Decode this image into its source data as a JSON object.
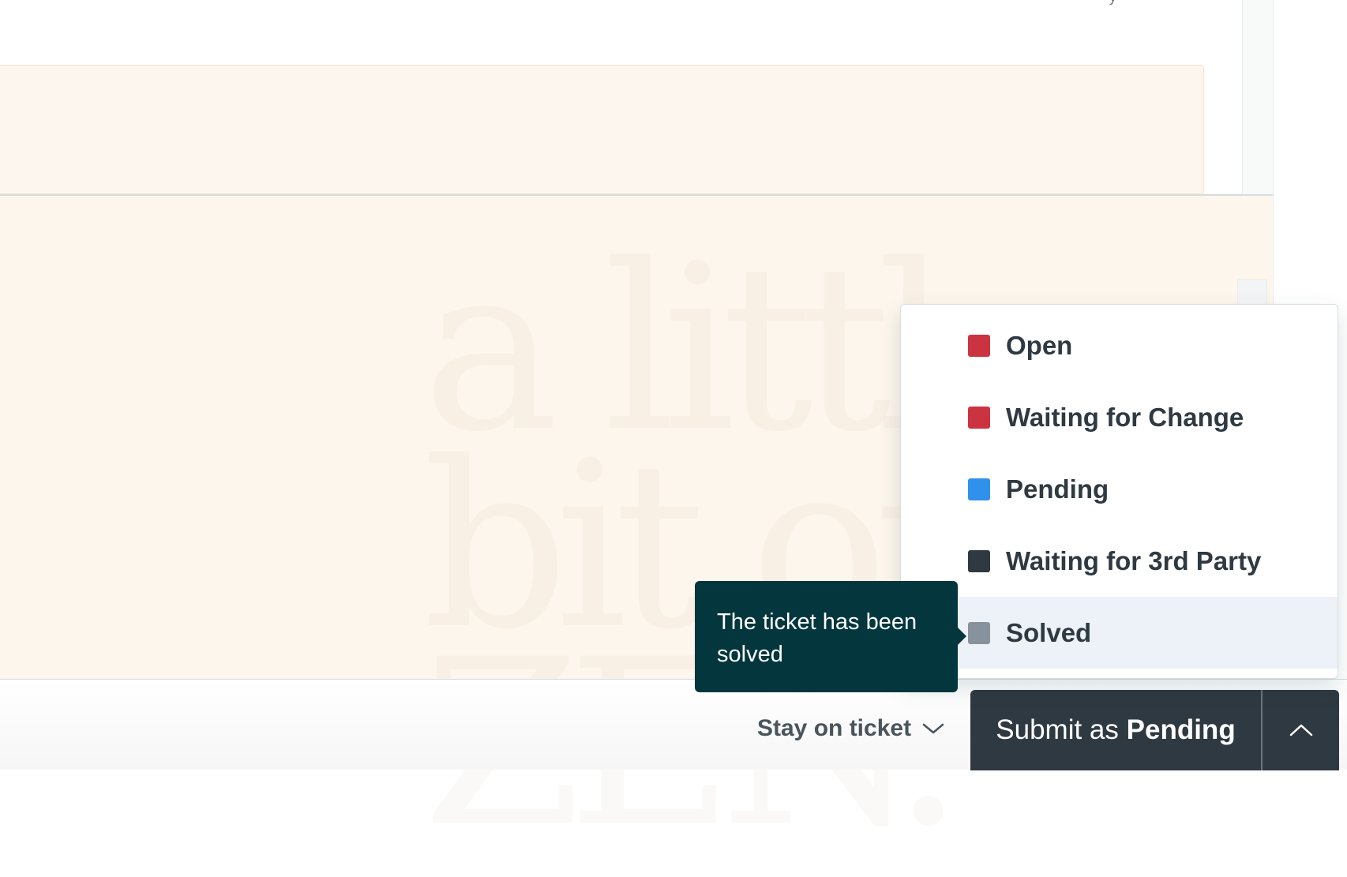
{
  "statuses": {
    "items": [
      {
        "label": "Open",
        "color": "#cc3340"
      },
      {
        "label": "Waiting for Change",
        "color": "#cc3340"
      },
      {
        "label": "Pending",
        "color": "#3091ec"
      },
      {
        "label": "Waiting for 3rd Party",
        "color": "#2f3941"
      },
      {
        "label": "Solved",
        "color": "#87929d"
      }
    ],
    "highlighted": "Solved"
  },
  "tooltip": {
    "text": "The ticket has been solved"
  },
  "footer": {
    "stay_label": "Stay on ticket",
    "submit_prefix": "Submit as",
    "submit_status": "Pending"
  },
  "background_art": {
    "line1": "a little",
    "line2": "bit of",
    "line3": "ZEN."
  },
  "icons": {
    "stay_chevron": "chevron-down-icon",
    "submit_chevron": "chevron-up-icon"
  }
}
